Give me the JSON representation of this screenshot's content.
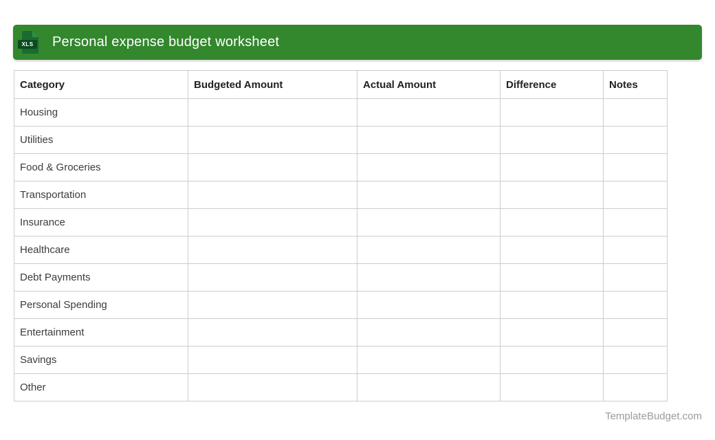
{
  "header": {
    "title": "Personal expense budget worksheet",
    "icon": {
      "label": "XLS"
    },
    "colors": {
      "bar": "#33872d",
      "icon_doc": "#1a6b2f",
      "icon_badge": "#0a4c1e"
    }
  },
  "table": {
    "columns": [
      "Category",
      "Budgeted Amount",
      "Actual Amount",
      "Difference",
      "Notes"
    ],
    "rows": [
      "Housing",
      "Utilities",
      "Food & Groceries",
      "Transportation",
      "Insurance",
      "Healthcare",
      "Debt Payments",
      "Personal Spending",
      "Entertainment",
      "Savings",
      "Other"
    ]
  },
  "footer": {
    "site": "TemplateBudget.com"
  }
}
